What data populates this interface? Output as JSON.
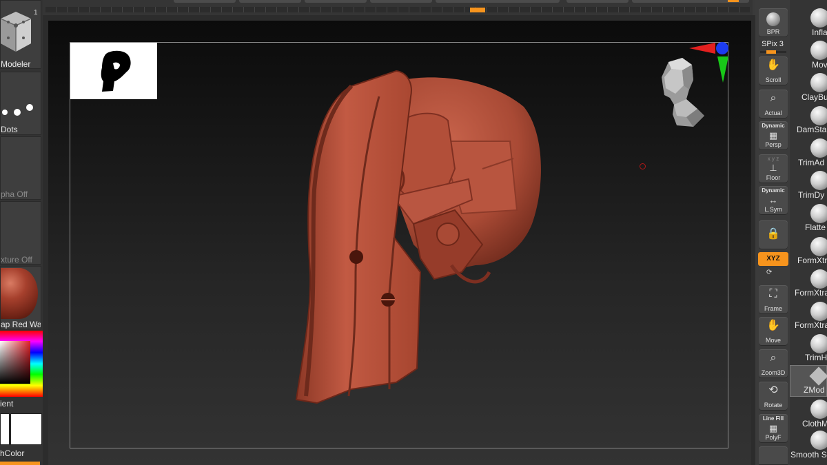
{
  "left_shelf": {
    "modeler_label": "Modeler",
    "modeler_badge": "1",
    "stroke_label": "Dots",
    "alpha_label": "pha Off",
    "texture_label": "xture Off",
    "material_label": "ap Red Wax",
    "gradient_label": "ient",
    "switch_color_label": "hColor"
  },
  "right_tools": {
    "bpr": "BPR",
    "spix": "SPix 3",
    "scroll": "Scroll",
    "actual": "Actual",
    "persp_top": "Dynamic",
    "persp": "Persp",
    "floor_top": "x  y  z",
    "floor": "Floor",
    "lsym_top": "Dynamic",
    "lsym": "L.Sym",
    "xyz": "XYZ",
    "frame": "Frame",
    "move": "Move",
    "zoom3d": "Zoom3D",
    "rotate": "Rotate",
    "polyf_top": "Line Fill",
    "polyf": "PolyF"
  },
  "brushes": [
    "Infla",
    "Mov",
    "ClayBu",
    "DamSta",
    "TrimAd",
    "TrimDy",
    "Flatte",
    "FormXtr",
    "FormXtra",
    "FormXtra",
    "TrimH",
    "ZMod",
    "ClothM",
    "Smooth S"
  ],
  "colors": {
    "accent": "#f7941d",
    "model": "#b0503b",
    "axis_x": "#e4201f",
    "axis_y": "#18c818",
    "axis_z": "#1c3cf0"
  }
}
